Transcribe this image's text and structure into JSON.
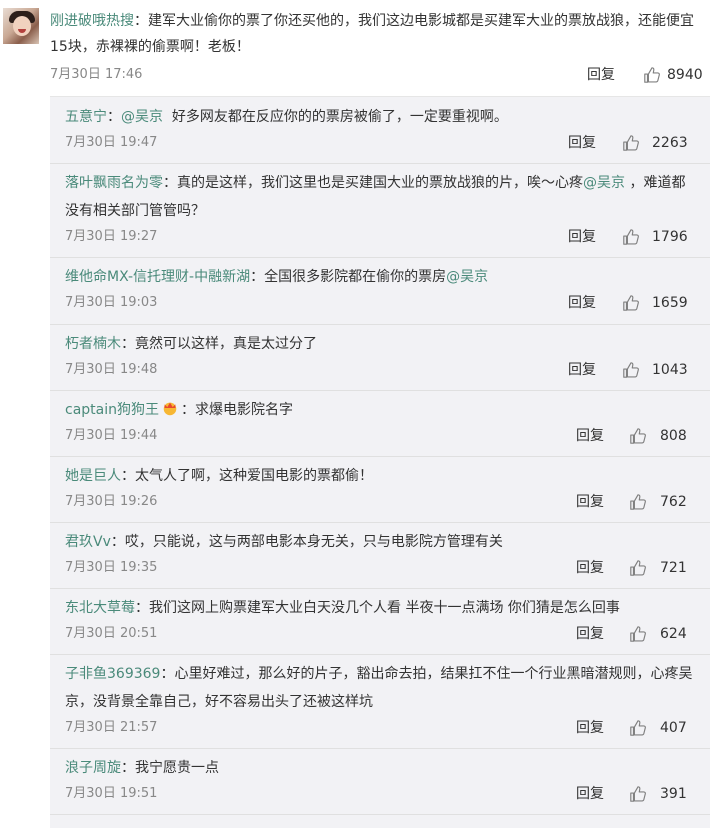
{
  "main_comment": {
    "username": "刚进破哦热搜",
    "text": "：建军大业偷你的票了你还买他的，我们这边电影城都是买建军大业的票放战狼，还能便宜15块，赤裸裸的偷票啊！老板！",
    "time": "7月30日 17:46",
    "reply_label": "回复",
    "likes": "8940"
  },
  "replies": [
    {
      "username": "五意宁",
      "text_before": "：",
      "mention": "@吴京",
      "text_after": "  好多网友都在反应你的的票房被偷了，一定要重视啊。",
      "time": "7月30日 19:47",
      "reply_label": "回复",
      "likes": "2263"
    },
    {
      "username": "落叶飘雨名为零",
      "text_before": "：真的是这样，我们这里也是买建国大业的票放战狼的片，唉～心疼",
      "mention": "@吴京",
      "text_after": " ，难道都没有相关部门管管吗？",
      "time": "7月30日 19:27",
      "reply_label": "回复",
      "likes": "1796"
    },
    {
      "username": "维他命MX-信托理财-中融新湖",
      "text_before": "：全国很多影院都在偷你的票房",
      "mention": "@吴京",
      "text_after": "",
      "time": "7月30日 19:03",
      "reply_label": "回复",
      "likes": "1659"
    },
    {
      "username": "朽者楠木",
      "text_before": "：竟然可以这样，真是太过分了",
      "mention": "",
      "text_after": "",
      "time": "7月30日 19:48",
      "reply_label": "回复",
      "likes": "1043"
    },
    {
      "username": "captain狗狗王",
      "text_before": "：求爆电影院名字",
      "mention": "",
      "text_after": "",
      "time": "7月30日 19:44",
      "reply_label": "回复",
      "likes": "808"
    },
    {
      "username": "她是巨人",
      "text_before": "：太气人了啊，这种爱国电影的票都偷！",
      "mention": "",
      "text_after": "",
      "time": "7月30日 19:26",
      "reply_label": "回复",
      "likes": "762"
    },
    {
      "username": "君玖Vv",
      "text_before": "：哎，只能说，这与两部电影本身无关，只与电影院方管理有关",
      "mention": "",
      "text_after": "",
      "time": "7月30日 19:35",
      "reply_label": "回复",
      "likes": "721"
    },
    {
      "username": "东北大草莓",
      "text_before": "：我们这网上购票建军大业白天没几个人看 半夜十一点满场 你们猜是怎么回事",
      "mention": "",
      "text_after": "",
      "time": "7月30日 20:51",
      "reply_label": "回复",
      "likes": "624"
    },
    {
      "username": "子非鱼369369",
      "text_before": "：心里好难过，那么好的片子，豁出命去拍，结果扛不住一个行业黑暗潜规则，心疼吴京，没背景全靠自己，好不容易出头了还被这样坑",
      "mention": "",
      "text_after": "",
      "time": "7月30日 21:57",
      "reply_label": "回复",
      "likes": "407"
    },
    {
      "username": "浪子周旋",
      "text_before": "：我宁愿贵一点",
      "mention": "",
      "text_after": "",
      "time": "7月30日 19:51",
      "reply_label": "回复",
      "likes": "391"
    }
  ],
  "colors": {
    "username": "#4a8a7a",
    "text": "#333333",
    "meta": "#888888",
    "reply_bg": "#f2f2f5"
  }
}
